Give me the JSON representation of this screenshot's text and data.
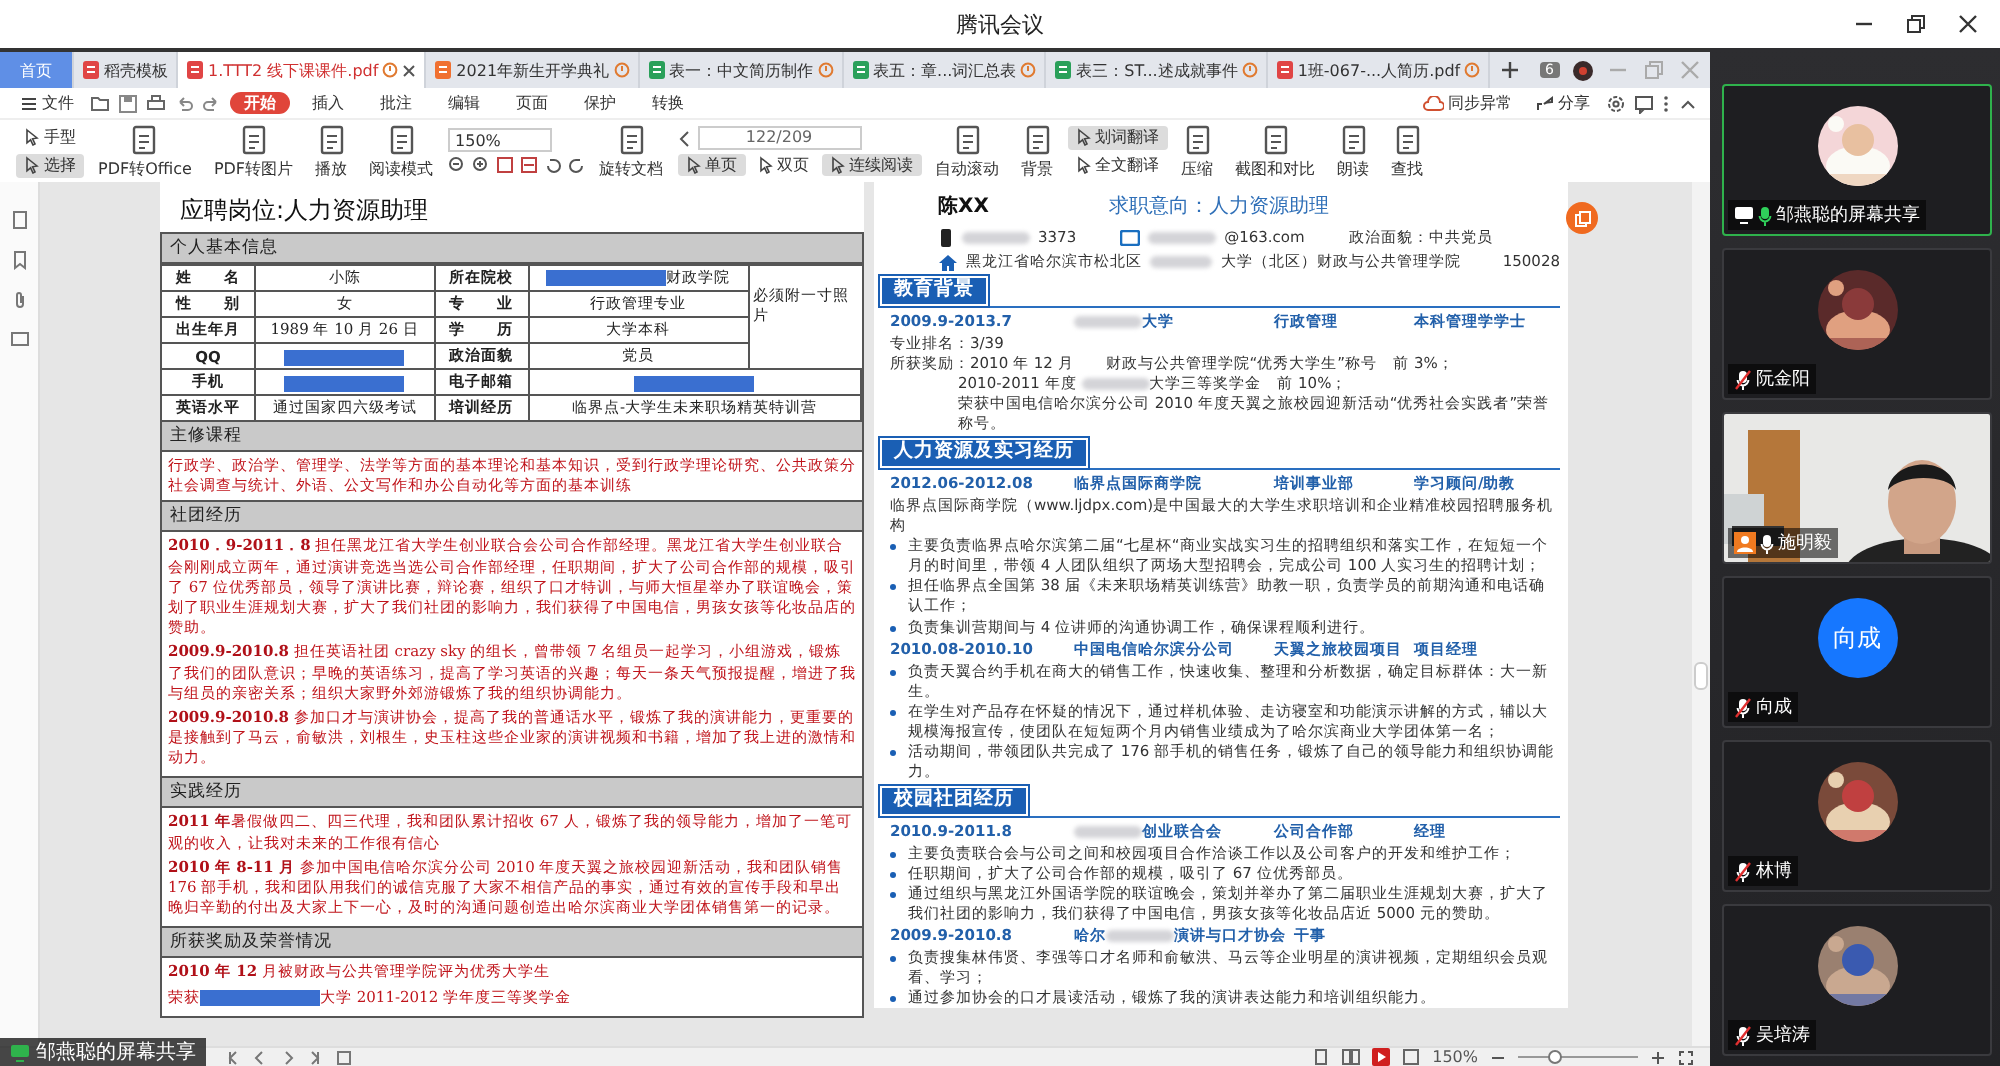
{
  "window": {
    "title": "腾讯会议"
  },
  "wps": {
    "tabs": [
      {
        "label": "首页",
        "kind": "home",
        "selected": false
      },
      {
        "label": "稻壳模板",
        "kind": "docer",
        "selected": false
      },
      {
        "label": "1.TTT2 线下课课件.pdf",
        "kind": "pdf",
        "selected": true
      },
      {
        "label": "2021年新生开学典礼",
        "kind": "slides",
        "selected": false
      },
      {
        "label": "表一：中文简历制作",
        "kind": "sheet",
        "selected": false
      },
      {
        "label": "表五：章...词汇总表",
        "kind": "sheet",
        "selected": false
      },
      {
        "label": "表三：ST...述成就事件",
        "kind": "sheet",
        "selected": false
      },
      {
        "label": "1班-067-...人简历.pdf",
        "kind": "pdf",
        "selected": false
      }
    ],
    "tab_count": "6",
    "menu": {
      "file": "文件",
      "tabs": [
        {
          "label": "开始",
          "selected": true
        },
        {
          "label": "插入",
          "selected": false
        },
        {
          "label": "批注",
          "selected": false
        },
        {
          "label": "编辑",
          "selected": false
        },
        {
          "label": "页面",
          "selected": false
        },
        {
          "label": "保护",
          "selected": false
        },
        {
          "label": "转换",
          "selected": false
        }
      ],
      "sync": "同步异常",
      "share": "分享"
    },
    "toolbar": [
      {
        "kind": "stack",
        "items": [
          {
            "label": "手型",
            "selected": false
          },
          {
            "label": "选择",
            "selected": true
          }
        ]
      },
      {
        "kind": "large",
        "label": "PDF转Office",
        "selected": false
      },
      {
        "kind": "large",
        "label": "PDF转图片",
        "selected": false
      },
      {
        "kind": "large",
        "label": "播放",
        "selected": false
      },
      {
        "kind": "large",
        "label": "阅读模式",
        "selected": false
      },
      {
        "kind": "zoom",
        "value": "150%"
      },
      {
        "kind": "large",
        "label": "旋转文档",
        "selected": false
      },
      {
        "kind": "pager",
        "value": "122/209",
        "items": [
          {
            "label": "单页",
            "selected": true
          },
          {
            "label": "双页",
            "selected": false
          },
          {
            "label": "连续阅读",
            "selected": true
          }
        ]
      },
      {
        "kind": "large",
        "label": "自动滚动",
        "selected": false
      },
      {
        "kind": "large",
        "label": "背景",
        "selected": false
      },
      {
        "kind": "stack",
        "items": [
          {
            "label": "划词翻译",
            "selected": true
          },
          {
            "label": "全文翻译",
            "selected": false
          }
        ]
      },
      {
        "kind": "large",
        "label": "压缩",
        "selected": false
      },
      {
        "kind": "large",
        "label": "截图和对比",
        "selected": false
      },
      {
        "kind": "large",
        "label": "朗读",
        "selected": false
      },
      {
        "kind": "large",
        "label": "查找",
        "selected": false
      }
    ],
    "statusbar": {
      "zoom": "150%",
      "zoom_slider": {
        "level": 0.3
      }
    }
  },
  "left_page": {
    "heading": "应聘岗位:人力资源助理",
    "sections": [
      {
        "kind": "table",
        "title": "个人基本信息",
        "photo_note": "必须附一寸照片",
        "rows": [
          {
            "kind": "with_photo",
            "cells": [
              [
                "姓　　名"
              ],
              [
                "小陈"
              ],
              [
                "所在院校"
              ],
              [
                {
                  "kind": "redact"
                },
                "财政学院"
              ]
            ]
          },
          {
            "kind": "with_photo",
            "cells": [
              [
                "性　　别"
              ],
              [
                "女"
              ],
              [
                "专　　业"
              ],
              [
                "行政管理专业"
              ]
            ]
          },
          {
            "kind": "with_photo",
            "cells": [
              [
                "出生年月"
              ],
              [
                "1989 年 10 月 26 日"
              ],
              [
                "学　　历"
              ],
              [
                "大学本科"
              ]
            ]
          },
          {
            "kind": "with_photo",
            "cells": [
              [
                "QQ"
              ],
              [
                {
                  "kind": "redact"
                }
              ],
              [
                "政治面貌"
              ],
              [
                "党员"
              ]
            ]
          },
          {
            "kind": "wide",
            "cells": [
              [
                "手机"
              ],
              [
                {
                  "kind": "redact"
                }
              ],
              [
                "电子邮箱"
              ],
              [
                {
                  "kind": "redact"
                }
              ]
            ]
          },
          {
            "kind": "wide",
            "cells": [
              [
                "英语水平"
              ],
              [
                "通过国家四六级考试"
              ],
              [
                "培训经历"
              ],
              [
                "临界点-大学生未来职场精英特训营"
              ]
            ]
          }
        ]
      },
      {
        "kind": "lines",
        "title": "主修课程",
        "lines": [
          "行政学、政治学、管理学、法学等方面的基本理论和基本知识，受到行政学理论研究、公共政策分",
          "社会调查与统计、外语、公文写作和办公自动化等方面的基本训练"
        ]
      },
      {
        "kind": "paragraphs",
        "title": "社团经历",
        "paragraphs": [
          "**2010．9-2011．8** 担任黑龙江省大学生创业联合会公司合作部经理。黑龙江省大学生创业联合会刚刚成立两年，通过演讲竞选当选公司合作部经理，任职期间，扩大了公司合作部的规模，吸引了 67 位优秀部员，领导了演讲比赛，辩论赛，组织了口才特训，与师大恒星举办了联谊晚会，策划了职业生涯规划大赛，扩大了我们社团的影响力，我们获得了中国电信，男孩女孩等化妆品店的赞助。",
          "**2009.9-2010.8** 担任英语社团 crazy sky 的组长，曾带领 7 名组员一起学习，小组游戏，锻炼了我们的团队意识；早晚的英语练习，提高了学习英语的兴趣；每天一条天气预报提醒，增进了我与组员的亲密关系；组织大家野外郊游锻炼了我的组织协调能力。",
          "**2009.9-2010.8** 参加口才与演讲协会，提高了我的普通话水平，锻炼了我的演讲能力，更重要的是接触到了马云，俞敏洪，刘根生，史玉柱这些企业家的演讲视频和书籍，增加了我上进的激情和动力。"
        ]
      },
      {
        "kind": "paragraphs",
        "title": "实践经历",
        "paragraphs": [
          "**2011 年**暑假做四二、四三代理，我和团队累计招收 67 人，锻炼了我的领导能力，增加了一笔可观的收入，让我对未来的工作很有信心",
          "**2010 年 8-11 月** 参加中国电信哈尔滨分公司 2010 年度天翼之旅校园迎新活动，我和团队销售 176 部手机，我和团队用我们的诚信克服了大家不相信产品的事实，通过有效的宣传手段和早出晚归辛勤的付出及大家上下一心，及时的沟通问题创造出哈尔滨商业大学团体销售第一的记录。"
        ]
      },
      {
        "kind": "awards",
        "title": "所获奖励及荣誉情况",
        "paragraphs": [
          "**2010 年 12** 月被财政与公共管理学院评为优秀大学生"
        ],
        "segments": [
          "荣获",
          {
            "kind": "redact"
          },
          "大学 2011-2012 学年度三等奖学金"
        ]
      }
    ]
  },
  "right_page": {
    "name": "陈XX",
    "intent": "求职意向：人力资源助理",
    "contacts": {
      "phone": [
        {
          "kind": "blur"
        },
        "3373"
      ],
      "email": [
        {
          "kind": "blur"
        },
        "@163.com"
      ],
      "politics": "政治面貌：中共党员",
      "address": [
        "黑龙江省哈尔滨市松北区",
        {
          "kind": "blur"
        },
        "大学（北区）财政与公共管理学院"
      ],
      "postcode": "150028"
    },
    "sections": [
      {
        "title": "教育背景",
        "entries": [
          {
            "cells": [
              [
                "2009.9-2013.7"
              ],
              [
                {
                  "kind": "blur"
                },
                "大学"
              ],
              [
                "行政管理"
              ],
              [
                "本科管理学学士"
              ]
            ],
            "lines": [
              {
                "kind": "plain",
                "segments": [
                  "专业排名：3/39"
                ]
              },
              {
                "kind": "plain",
                "segments": [
                  "所获奖励：2010 年 12 月　　财政与公共管理学院“优秀大学生”称号　前 3%；"
                ]
              },
              {
                "kind": "continued",
                "segments": [
                  "2010-2011 年度 ",
                  {
                    "kind": "blur"
                  },
                  "大学三等奖学金　前 10%；"
                ]
              },
              {
                "kind": "continued",
                "segments": [
                  "荣获中国电信哈尔滨分公司 2010 年度天翼之旅校园迎新活动“优秀社会实践者”荣誉称号。"
                ]
              }
            ]
          }
        ]
      },
      {
        "title": "人力资源及实习经历",
        "entries": [
          {
            "cells": [
              [
                "2012.06-2012.08"
              ],
              [
                "临界点国际商学院"
              ],
              [
                "培训事业部"
              ],
              [
                "学习顾问/助教"
              ]
            ],
            "intro": "临界点国际商学院（www.ljdpx.com)是中国最大的大学生求职培训和企业精准校园招聘服务机构",
            "bullets": [
              "主要负责临界点哈尔滨第二届“七星杯“商业实战实习生的招聘组织和落实工作，在短短一个月的时间里，带领 4 人团队组织了两场大型招聘会，完成公司 100 人实习生的招聘计划；",
              "担任临界点全国第 38 届《未来职场精英训练营》助教一职，负责学员的前期沟通和电话确认工作；",
              "负责集训营期间与 4 位讲师的沟通协调工作，确保课程顺利进行。"
            ]
          },
          {
            "cells": [
              [
                "2010.08-2010.10"
              ],
              [
                "中国电信哈尔滨分公司"
              ],
              [
                "天翼之旅校园项目"
              ],
              [
                "项目经理"
              ]
            ],
            "bullets": [
              "负责天翼合约手机在商大的销售工作，快速收集、整理和分析数据，确定目标群体：大一新生。",
              "在学生对产品存在怀疑的情况下，通过样机体验、走访寝室和功能演示讲解的方式，辅以大规模海报宣传，使团队在短短两个月内销售业绩成为了哈尔滨商业大学团体第一名；",
              "活动期间，带领团队共完成了 176 部手机的销售任务，锻炼了自己的领导能力和组织协调能力。"
            ]
          }
        ]
      },
      {
        "title": "校园社团经历",
        "entries": [
          {
            "cells": [
              [
                "2010.9-2011.8"
              ],
              [
                {
                  "kind": "blur"
                },
                "创业联合会"
              ],
              [
                "公司合作部"
              ],
              [
                "经理"
              ]
            ],
            "bullets": [
              "主要负责联合会与公司之间和校园项目合作洽谈工作以及公司客户的开发和维护工作；",
              "任职期间，扩大了公司合作部的规模，吸引了 67 位优秀部员。",
              "通过组织与黑龙江外国语学院的联谊晚会，策划并举办了第二届职业生涯规划大赛，扩大了我们社团的影响力，我们获得了中国电信，男孩女孩等化妆品店近 5000 元的赞助。"
            ]
          },
          {
            "cells": [
              [
                "2009.9-2010.8"
              ],
              [
                "哈尔",
                {
                  "kind": "blur"
                },
                "演讲与口才协会"
              ],
              [
                "干事"
              ]
            ],
            "bullets": [
              "负责搜集林伟贤、李强等口才名师和俞敏洪、马云等企业明星的演讲视频，定期组织会员观看、学习；",
              "通过参加协会的口才晨读活动，锻炼了我的演讲表达能力和培训组织能力。"
            ]
          }
        ]
      }
    ]
  },
  "share_label": "邹燕聪的屏幕共享",
  "participants": [
    {
      "name": "邹燕聪的屏幕共享",
      "muted": false,
      "speaking": true,
      "sharing": true,
      "host": false,
      "highlighted": true
    },
    {
      "name": "阮金阳",
      "muted": true,
      "speaking": false,
      "sharing": false,
      "host": false,
      "highlighted": false
    },
    {
      "name": "施明毅",
      "muted": false,
      "speaking": false,
      "sharing": false,
      "host": true,
      "highlighted": false,
      "avatar": {
        "kind": "video"
      }
    },
    {
      "name": "向成",
      "muted": true,
      "speaking": false,
      "sharing": false,
      "host": false,
      "highlighted": false,
      "avatar": {
        "kind": "initials",
        "text": "向成"
      }
    },
    {
      "name": "林博",
      "muted": true,
      "speaking": false,
      "sharing": false,
      "host": false,
      "highlighted": false
    },
    {
      "name": "吴培涛",
      "muted": true,
      "speaking": false,
      "sharing": false,
      "host": false,
      "highlighted": false
    }
  ]
}
